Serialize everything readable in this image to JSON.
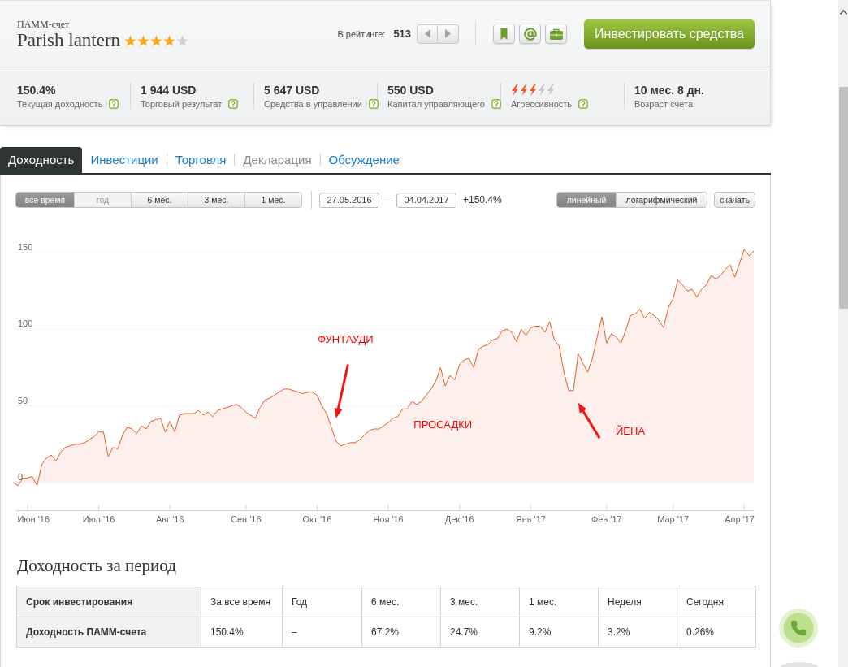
{
  "account": {
    "type_label": "ПАММ-счет",
    "name": "Parish lantern",
    "stars": 4
  },
  "rating": {
    "label": "В рейтинге:",
    "value": "513"
  },
  "invest_button": "Инвестировать средства",
  "stats": [
    {
      "kind": "value",
      "value": "150.4%",
      "label": "Текущая доходность",
      "help": true
    },
    {
      "kind": "value",
      "value": "1 944 USD",
      "label": "Торговый результат",
      "help": true
    },
    {
      "kind": "value",
      "value": "5 647 USD",
      "label": "Средства в управлении",
      "help": true
    },
    {
      "kind": "value",
      "value": "550 USD",
      "label": "Капитал управляющего",
      "help": true
    },
    {
      "kind": "meter",
      "level": 0.6,
      "label": "Агрессивность",
      "help": true
    },
    {
      "kind": "value",
      "value": "10 мес. 8 дн.",
      "label": "Возраст счета",
      "help": false
    }
  ],
  "tabs": [
    {
      "label": "Доходность",
      "selected": true,
      "disabled": false
    },
    {
      "label": "Инвестиции",
      "selected": false,
      "disabled": false
    },
    {
      "label": "Торговля",
      "selected": false,
      "disabled": false
    },
    {
      "label": "Декларация",
      "selected": false,
      "disabled": true
    },
    {
      "label": "Обсуждение",
      "selected": false,
      "disabled": false
    }
  ],
  "period_buttons": [
    {
      "label": "все время",
      "selected": true,
      "disabled": false
    },
    {
      "label": "год",
      "selected": false,
      "disabled": true
    },
    {
      "label": "6 мес.",
      "selected": false,
      "disabled": false
    },
    {
      "label": "3 мес.",
      "selected": false,
      "disabled": false
    },
    {
      "label": "1 мес.",
      "selected": false,
      "disabled": false
    }
  ],
  "date_range": {
    "from": "27.05.2016",
    "separator": "—",
    "to": "04.04.2017",
    "change": "+150.4%"
  },
  "scale_buttons": [
    {
      "label": "линейный",
      "selected": true
    },
    {
      "label": "логарифмический",
      "selected": false
    }
  ],
  "download_button": "скачать",
  "chart": {
    "chart_data": {
      "type": "area",
      "grid": true,
      "categories": [
        null,
        null,
        null,
        "Июн '16",
        null,
        null,
        null,
        null,
        null,
        null,
        null,
        null,
        null,
        null,
        null,
        null,
        null,
        null,
        "Июл '16",
        null,
        null,
        null,
        null,
        null,
        null,
        null,
        null,
        null,
        null,
        null,
        null,
        null,
        null,
        "Авг '16",
        null,
        null,
        null,
        null,
        null,
        null,
        null,
        null,
        null,
        null,
        null,
        null,
        null,
        null,
        null,
        "Сен '16",
        null,
        null,
        null,
        null,
        null,
        null,
        null,
        null,
        null,
        null,
        null,
        null,
        null,
        null,
        "Окт '16",
        null,
        null,
        null,
        null,
        null,
        null,
        null,
        null,
        null,
        null,
        null,
        null,
        null,
        null,
        "Ноя '16",
        null,
        null,
        null,
        null,
        null,
        null,
        null,
        null,
        null,
        null,
        null,
        null,
        null,
        null,
        "Дек '16",
        null,
        null,
        null,
        null,
        null,
        null,
        null,
        null,
        null,
        null,
        null,
        null,
        null,
        null,
        "Янв '17",
        null,
        null,
        null,
        null,
        null,
        null,
        null,
        null,
        null,
        null,
        null,
        null,
        null,
        null,
        null,
        "Фев '17",
        null,
        null,
        null,
        null,
        null,
        null,
        null,
        null,
        null,
        null,
        null,
        null,
        null,
        "Мар '17",
        null,
        null,
        null,
        null,
        null,
        null,
        null,
        null,
        null,
        null,
        null,
        null,
        null,
        null,
        "Апр '17",
        null,
        null
      ],
      "values": [
        0,
        -2,
        3,
        3,
        4,
        -2,
        12,
        16,
        18,
        14,
        20,
        23,
        24,
        25,
        25,
        26,
        28,
        30,
        33,
        33,
        17,
        23,
        22,
        31,
        36,
        35,
        32,
        37,
        35,
        40,
        41,
        42,
        33,
        40,
        33,
        44,
        45,
        45,
        45,
        47,
        44,
        46,
        43,
        47,
        48,
        49,
        50,
        51,
        49,
        46,
        44,
        42,
        49,
        54,
        55,
        57,
        59,
        61,
        61,
        60,
        59,
        58,
        59,
        59,
        57,
        50,
        45,
        36,
        27,
        24,
        25,
        26,
        26,
        28,
        31,
        34,
        35,
        35,
        37,
        39,
        42,
        43,
        48,
        48,
        53,
        51,
        53,
        57,
        61,
        66,
        75,
        63,
        70,
        67,
        77,
        80,
        81,
        75,
        87,
        89,
        90,
        93,
        94,
        99,
        100,
        98,
        92,
        100,
        96,
        101,
        102,
        102,
        98,
        105,
        93,
        89,
        72,
        60,
        60,
        84,
        78,
        72,
        81,
        95,
        108,
        91,
        97,
        95,
        91,
        99,
        109,
        110,
        113,
        107,
        111,
        109,
        106,
        101,
        114,
        120,
        132,
        129,
        125,
        126,
        121,
        126,
        129,
        135,
        133,
        135,
        139,
        142,
        134,
        143,
        152,
        148,
        151
      ],
      "ylim": [
        -18,
        160
      ],
      "yticks": [
        0,
        50,
        100,
        150
      ],
      "annotations": [
        "ФУНТАУДИ",
        "ПРОСАДКИ",
        "ЙЕНА"
      ]
    }
  },
  "period_returns": {
    "title": "Доходность за период",
    "rows": [
      {
        "label": "Срок инвестирования",
        "cells": [
          "За все время",
          "Год",
          "6 мес.",
          "3 мес.",
          "1 мес.",
          "Неделя",
          "Сегодня"
        ]
      },
      {
        "label": "Доходность ПАММ-счета",
        "cells": [
          "150.4%",
          "–",
          "67.2%",
          "24.7%",
          "9.2%",
          "3.2%",
          "0.26%"
        ]
      }
    ]
  }
}
